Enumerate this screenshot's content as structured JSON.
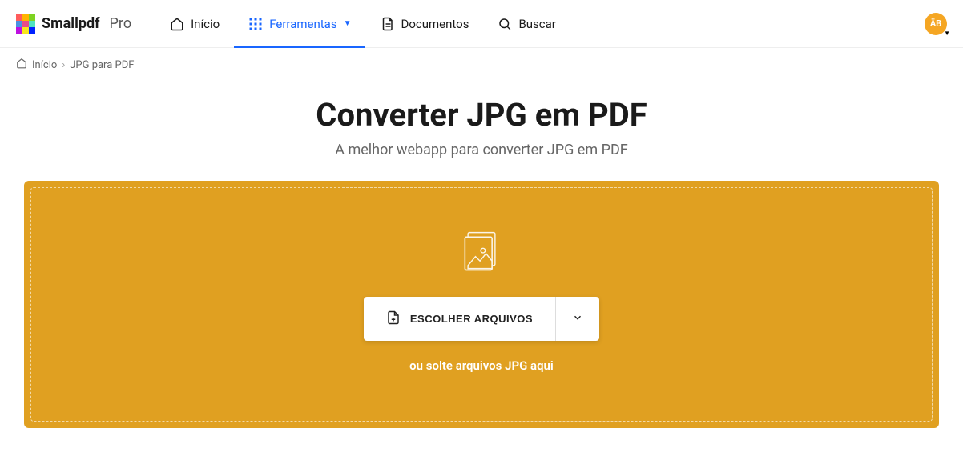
{
  "brand": {
    "name": "Smallpdf",
    "tier": "Pro"
  },
  "nav": {
    "home": "Início",
    "tools": "Ferramentas",
    "documents": "Documentos",
    "search": "Buscar"
  },
  "avatar": {
    "initials": "ÄB"
  },
  "breadcrumb": {
    "home": "Início",
    "current": "JPG para PDF"
  },
  "hero": {
    "title": "Converter JPG em PDF",
    "subtitle": "A melhor webapp para converter JPG em PDF"
  },
  "dropzone": {
    "choose": "ESCOLHER ARQUIVOS",
    "hint": "ou solte arquivos JPG aqui"
  },
  "colors": {
    "accent": "#1966ff",
    "dropzone": "#e0a021",
    "avatar": "#f5a623"
  }
}
